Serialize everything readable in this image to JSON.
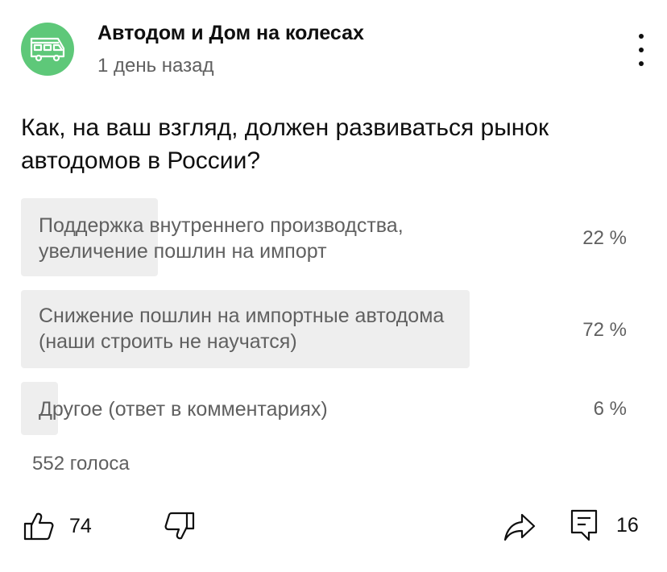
{
  "channel": {
    "name": "Автодом и Дом на колесах",
    "time": "1 день назад",
    "avatar_icon": "camper-van-icon",
    "avatar_color": "#5ec879"
  },
  "post": {
    "question": "Как, на ваш взгляд, должен развиваться рынок автодомов в России?"
  },
  "poll": {
    "options": [
      {
        "line1": "Поддержка внутреннего производства,",
        "line2": "увеличение пошлин на импорт",
        "percent_label": "22 %",
        "share": 0.22
      },
      {
        "line1": "Снижение пошлин на импортные автодома",
        "line2": "(наши строить не научатся)",
        "percent_label": "72 %",
        "share": 0.72
      },
      {
        "line1": "Другое (ответ в комментариях)",
        "line2": "",
        "percent_label": "6 %",
        "share": 0.06
      }
    ],
    "votes": "552 голоса",
    "fill_color": "#eeeeee"
  },
  "actions": {
    "likes": "74",
    "comments": "16",
    "like_icon": "thumbs-up-icon",
    "dislike_icon": "thumbs-down-icon",
    "share_icon": "share-icon",
    "comment_icon": "comment-icon"
  },
  "menu_icon": "more-vertical-icon"
}
